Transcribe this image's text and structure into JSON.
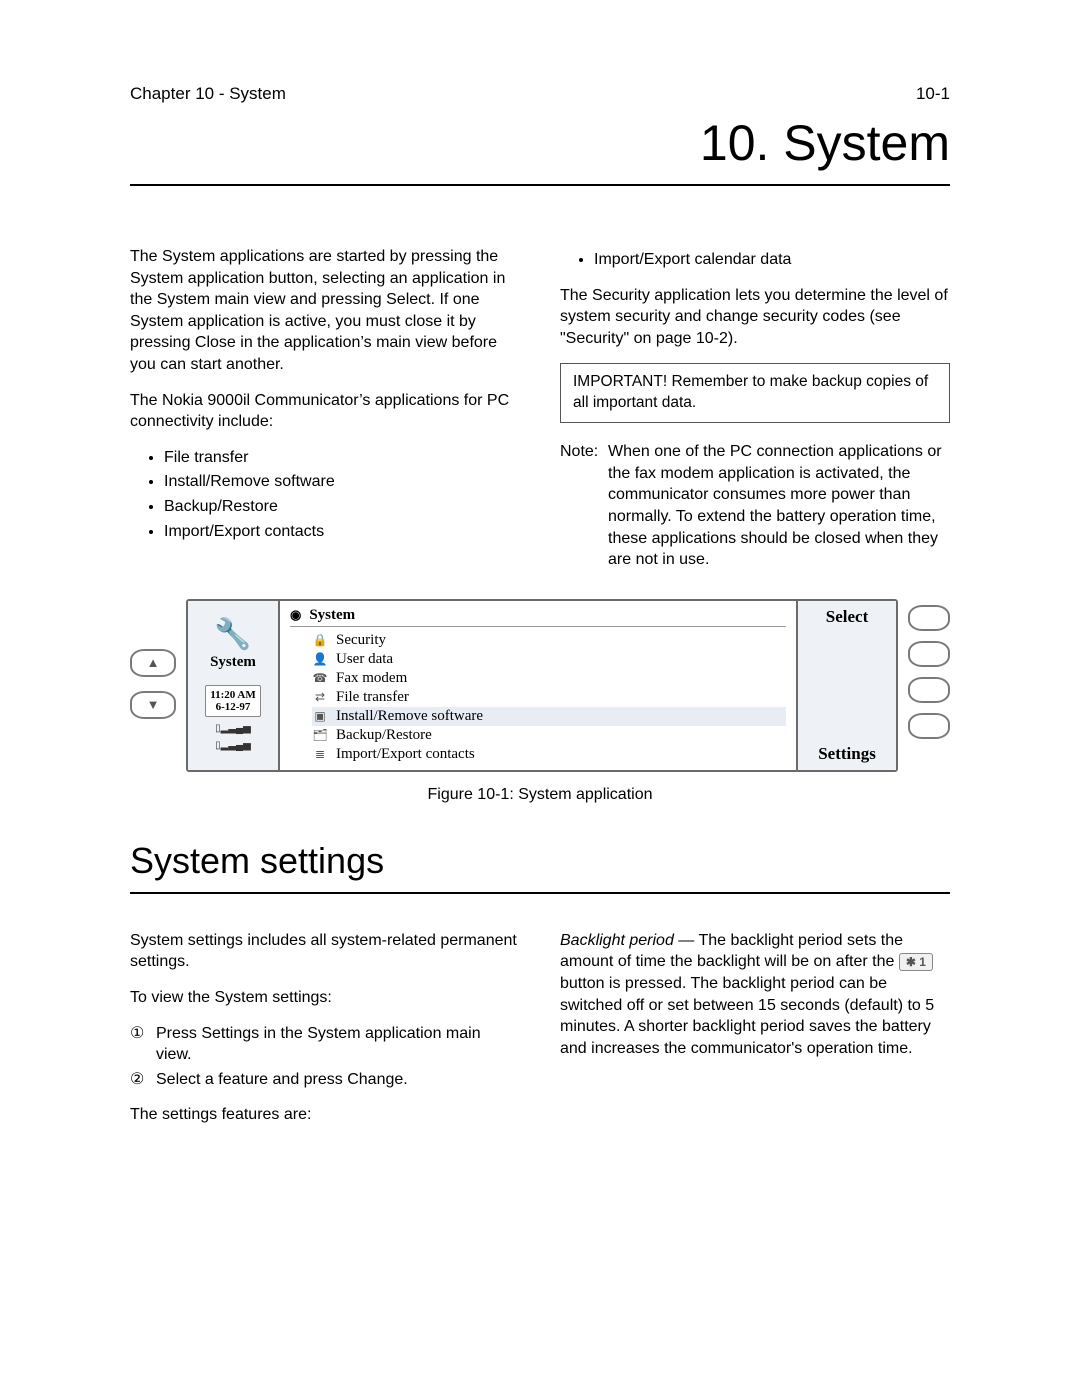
{
  "header": {
    "left": "Chapter 10 - System",
    "right": "10-1"
  },
  "title": "10. System",
  "col1": {
    "p1": "The System applications are started by pressing the System application button, selecting an application in the System main view and pressing Select. If one System application is active, you must close it by pressing Close in the application’s main view before you can start another.",
    "p2": "The Nokia 9000il Communicator’s applications for PC connectivity include:",
    "bullets": [
      "File transfer",
      "Install/Remove software",
      "Backup/Restore",
      "Import/Export contacts"
    ]
  },
  "col2": {
    "bullets": [
      "Import/Export calendar data"
    ],
    "p1": "The Security application lets you determine the level of system security and change security codes (see \"Security\" on page 10-2).",
    "important": "IMPORTANT! Remember to make backup copies of all important data.",
    "note_label": "Note:",
    "note_body": "When one of the PC connection applications or the fax modem application is activated, the communicator consumes more power than normally. To extend the battery operation time, these applications should be closed when they are not in use."
  },
  "figure": {
    "left_label": "System",
    "time": "11:20 AM",
    "date": "6-12-97",
    "center_title": "System",
    "items": [
      "Security",
      "User data",
      "Fax modem",
      "File transfer",
      "Install/Remove software",
      "Backup/Restore",
      "Import/Export contacts"
    ],
    "right_top": "Select",
    "right_bottom": "Settings",
    "caption": "Figure 10-1: System application"
  },
  "section2_title": "System settings",
  "col3": {
    "p1": "System settings includes all system-related permanent settings.",
    "p2": "To view the System settings:",
    "steps": [
      "Press Settings in the System application main view.",
      "Select a feature and press Change."
    ],
    "p3": "The settings features are:"
  },
  "col4": {
    "term": "Backlight period",
    "p1a": " — The backlight period sets the amount of time the backlight will be on after the ",
    "key_icon": "✱ 1",
    "p1b": " button is pressed. The backlight period can be switched off or set between 15 seconds (default) to 5 minutes. A shorter backlight period saves the battery and increases the communicator's operation time."
  }
}
